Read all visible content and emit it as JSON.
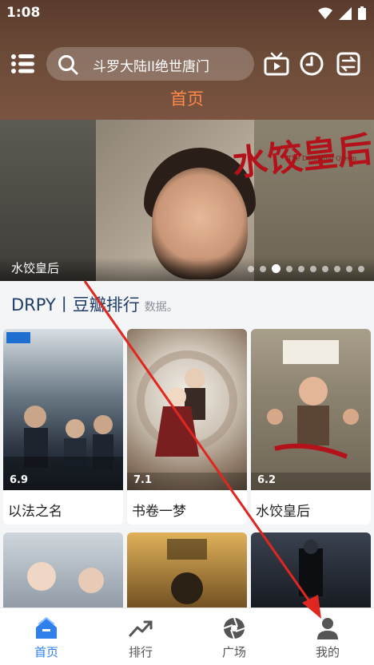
{
  "status_bar": {
    "time": "1:08"
  },
  "header": {
    "search_text": "斗罗大陆II绝世唐门",
    "active_tab": "首页"
  },
  "banner": {
    "caption": "水饺皇后",
    "calligraphy": "水饺皇后",
    "english_subtitle": "The Dumpling Queen",
    "dot_count": 10,
    "active_dot": 2
  },
  "section": {
    "title": "DRPY丨豆瓣排行",
    "note": "数据。"
  },
  "cards": [
    {
      "name": "以法之名",
      "rating": "6.9",
      "accent": "#2a3b4a"
    },
    {
      "name": "书卷一梦",
      "rating": "7.1",
      "accent": "#8b6a5a"
    },
    {
      "name": "水饺皇后",
      "rating": "6.2",
      "accent": "#7c6a52"
    }
  ],
  "row2_cards": [
    {
      "accent": "#6b7a8a"
    },
    {
      "accent": "#8a6a2a"
    },
    {
      "accent": "#2a2f3a"
    }
  ],
  "bottom_nav": [
    {
      "label": "首页",
      "icon": "home-icon",
      "active": true
    },
    {
      "label": "排行",
      "icon": "trending-icon",
      "active": false
    },
    {
      "label": "广场",
      "icon": "aperture-icon",
      "active": false
    },
    {
      "label": "我的",
      "icon": "user-icon",
      "active": false
    }
  ],
  "colors": {
    "accent_orange": "#ff8a4c",
    "active_blue": "#2f80ed",
    "section_title": "#1f3d66"
  }
}
